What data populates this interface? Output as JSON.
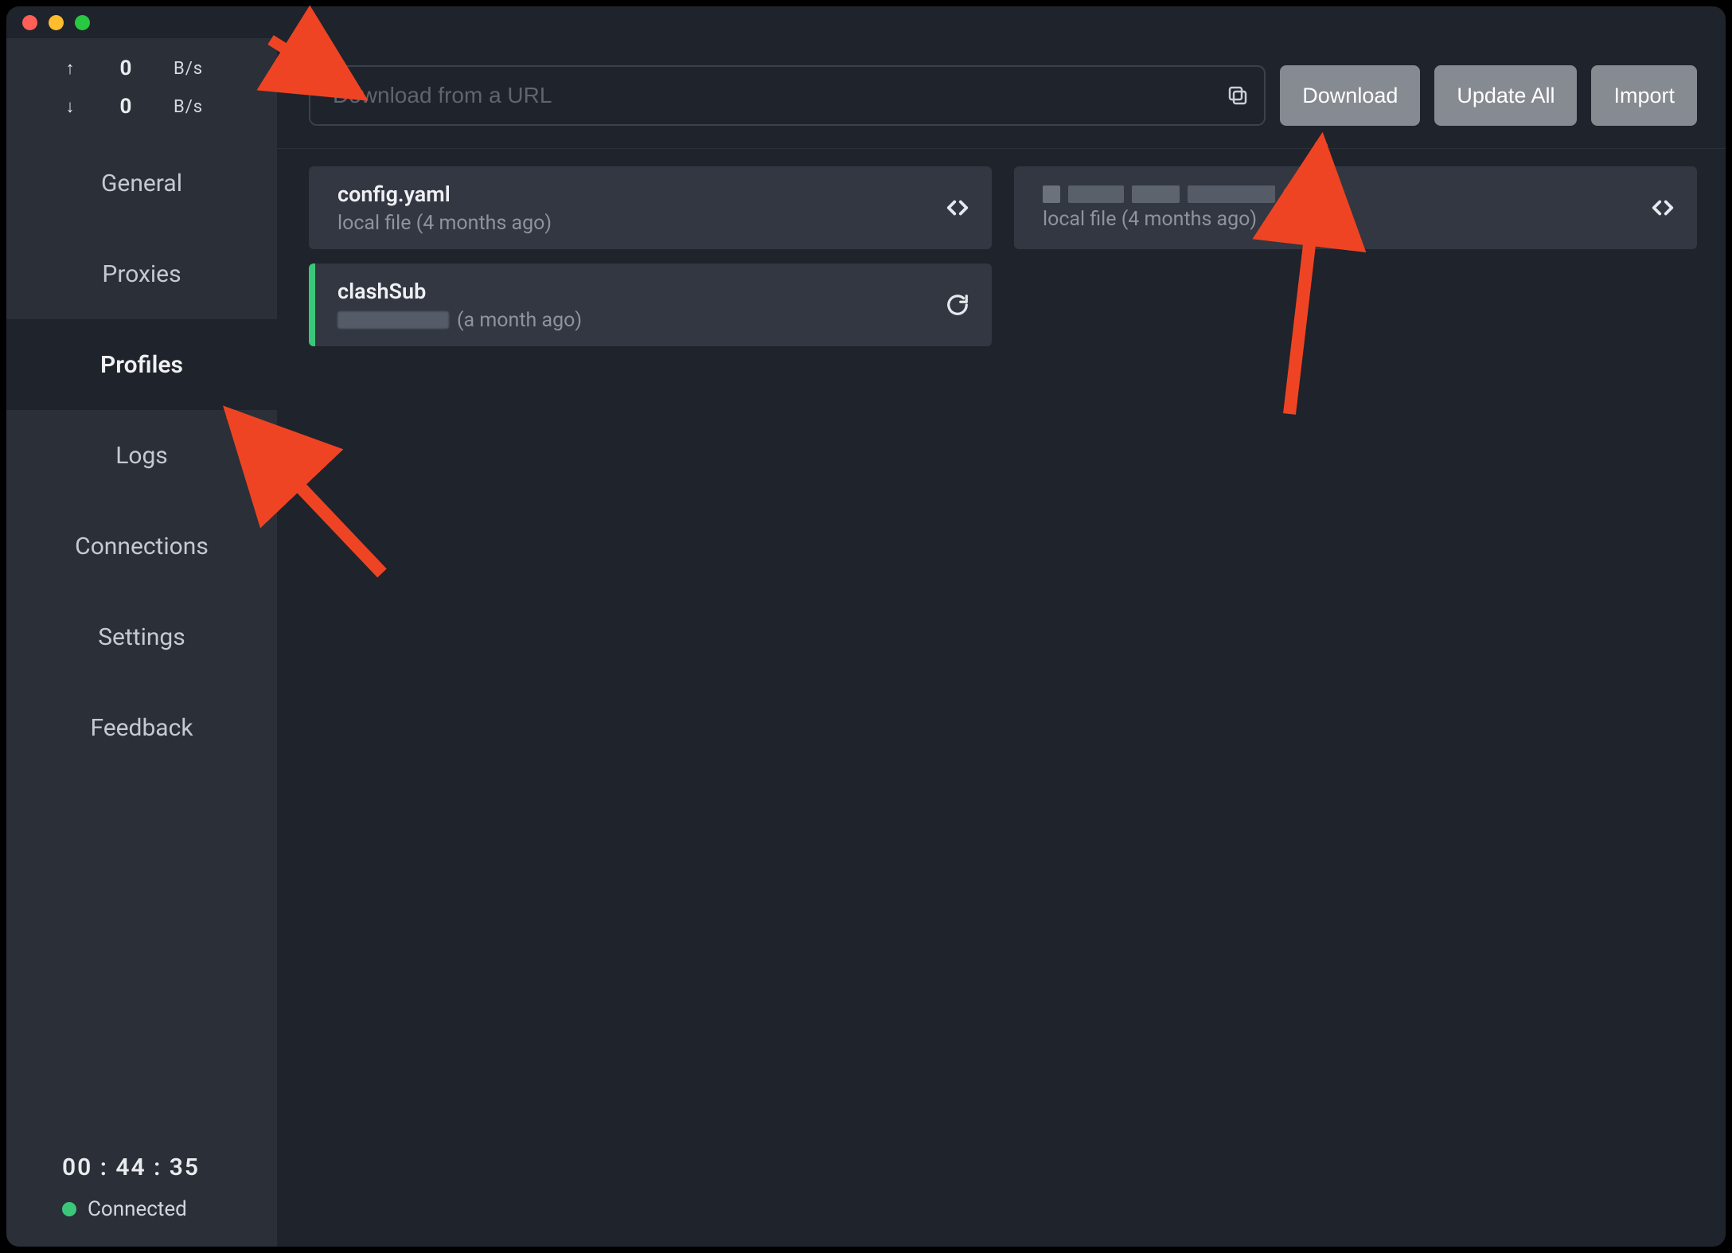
{
  "sidebar": {
    "speed": {
      "up_value": "0",
      "up_unit": "B/s",
      "down_value": "0",
      "down_unit": "B/s"
    },
    "nav": {
      "general": "General",
      "proxies": "Proxies",
      "profiles": "Profiles",
      "logs": "Logs",
      "connections": "Connections",
      "settings": "Settings",
      "feedback": "Feedback"
    },
    "timer": "00 : 44 : 35",
    "status_label": "Connected"
  },
  "toolbar": {
    "url_placeholder": "Download from a URL",
    "download_label": "Download",
    "update_all_label": "Update All",
    "import_label": "Import"
  },
  "profiles": {
    "card1": {
      "title": "config.yaml",
      "subtitle": "local file (4 months ago)"
    },
    "card2": {
      "subtitle": "local file (4 months ago)"
    },
    "card3": {
      "title": "clashSub",
      "time_suffix": "(a month ago)"
    }
  }
}
